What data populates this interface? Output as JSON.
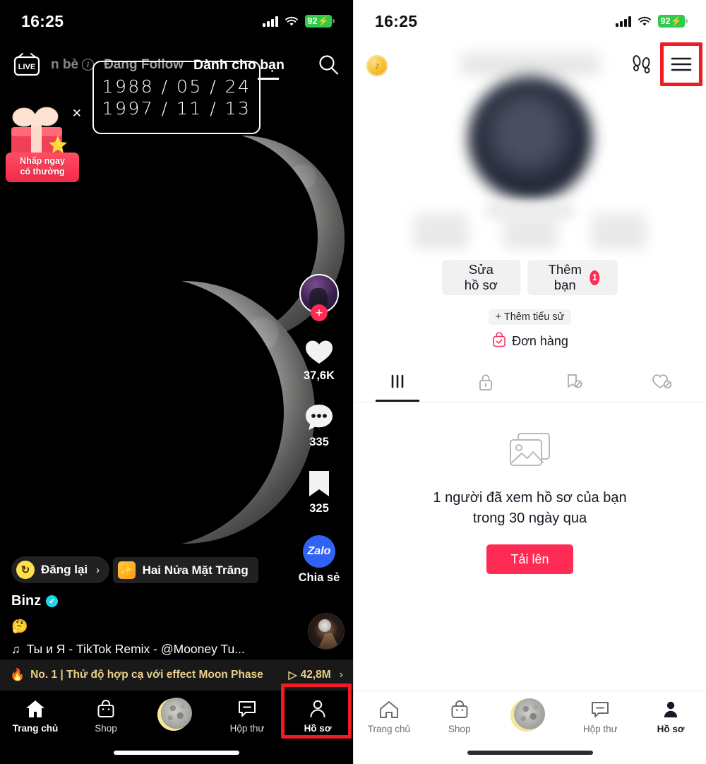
{
  "left_screen": {
    "status_bar": {
      "time": "16:25",
      "battery": "92",
      "battery_icon": "battery-charging-icon",
      "wifi_icon": "wifi-icon",
      "signal_icon": "cellular-signal-icon"
    },
    "top_nav": {
      "live_label": "LIVE",
      "tab_friends": "n bè",
      "tab_following": "Đang Follow",
      "tab_foryou": "Dành cho bạn",
      "search_icon": "search-icon",
      "info_icon": "i"
    },
    "date_overlay": {
      "line1": "1988 / 05 / 24",
      "line2": "1997 / 11 / 13"
    },
    "gift_promo": {
      "line1": "Nhấp ngay",
      "line2": "có thưởng",
      "close_icon": "✕"
    },
    "action_rail": {
      "like_count": "37,6K",
      "comment_count": "335",
      "bookmark_count": "325",
      "share_app": "Zalo",
      "share_label": "Chia sẻ",
      "follow_plus": "+"
    },
    "video_info": {
      "repost_label": "Đăng lại",
      "repost_arrow": "›",
      "repost_icon": "repost-icon",
      "effect_label": "Hai Nửa Mặt Trăng",
      "effect_icon": "✨",
      "author": "Binz",
      "verified_icon": "✓",
      "caption_emoji": "🤔",
      "music_note": "♫",
      "music_text": "Ты и Я - TikTok Remix - @Mooney Tu..."
    },
    "trending_banner": {
      "flame": "🔥",
      "text": "No. 1 | Thử độ hợp cạ với effect Moon Phase",
      "views": "42,8M",
      "play_icon": "▷",
      "chevron": "›"
    },
    "tab_bar": {
      "items": [
        {
          "label": "Trang chủ",
          "icon": "home-icon"
        },
        {
          "label": "Shop",
          "icon": "shop-bag-icon"
        },
        {
          "label": "",
          "icon": "moon-create-icon"
        },
        {
          "label": "Hộp thư",
          "icon": "inbox-icon"
        },
        {
          "label": "Hồ sơ",
          "icon": "person-icon"
        }
      ],
      "highlighted_index": 4
    }
  },
  "right_screen": {
    "status_bar": {
      "time": "16:25",
      "battery": "92",
      "battery_icon": "battery-charging-icon",
      "wifi_icon": "wifi-icon",
      "signal_icon": "cellular-signal-icon"
    },
    "header": {
      "coin_icon": "tiktok-coin-icon",
      "coin_glyph": "♪",
      "footprints_icon": "footprints-icon",
      "menu_icon": "hamburger-menu-icon",
      "menu_highlighted": true
    },
    "profile": {
      "display_name_blurred": true,
      "avatar_blurred": true,
      "handle_blurred": true,
      "stats_blurred": true,
      "edit_profile_button": "Sửa hồ sơ",
      "add_friends_button": "Thêm bạn",
      "add_friends_badge": "1",
      "add_bio_button": "+ Thêm tiểu sử",
      "orders_label": "Đơn hàng",
      "orders_icon": "order-bag-icon"
    },
    "tabs": [
      {
        "icon": "posts-grid-icon",
        "active": true
      },
      {
        "icon": "lock-icon",
        "active": false
      },
      {
        "icon": "bookmark-hidden-icon",
        "active": false
      },
      {
        "icon": "heart-hidden-icon",
        "active": false
      }
    ],
    "empty_state": {
      "image_icon": "photo-stack-icon",
      "line1": "1 người đã xem hồ sơ của bạn",
      "line2": "trong 30 ngày qua",
      "upload_button": "Tải lên"
    },
    "tab_bar": {
      "items": [
        {
          "label": "Trang chủ",
          "icon": "home-icon"
        },
        {
          "label": "Shop",
          "icon": "shop-bag-icon"
        },
        {
          "label": "",
          "icon": "moon-create-icon"
        },
        {
          "label": "Hộp thư",
          "icon": "inbox-icon"
        },
        {
          "label": "Hồ sơ",
          "icon": "person-icon"
        }
      ],
      "active_index": 4
    }
  },
  "colors": {
    "accent_pink": "#fe2c55",
    "highlight_red": "#ef1c24",
    "battery_green": "#2ecc4a",
    "verified_blue": "#20d5ec",
    "zalo_blue": "#2f62f5",
    "gold": "#e9d08a"
  }
}
